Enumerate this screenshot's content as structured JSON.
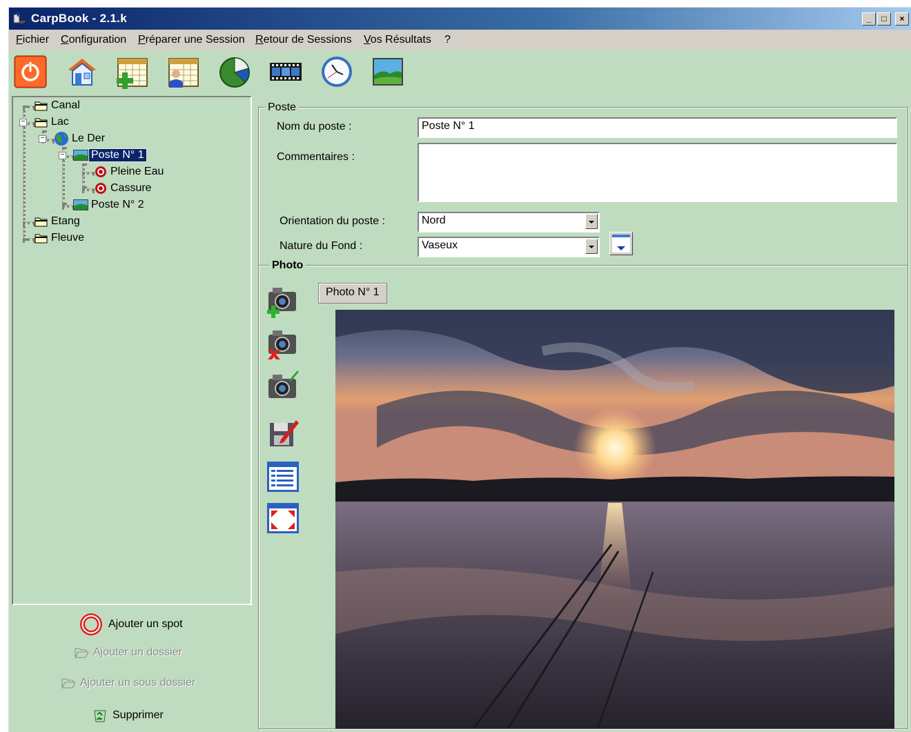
{
  "window": {
    "title": "CarpBook - 2.1.k"
  },
  "menu": [
    {
      "text": "Fichier",
      "mnemonic": "F",
      "rest": "ichier"
    },
    {
      "text": "Configuration",
      "mnemonic": "C",
      "rest": "onfiguration"
    },
    {
      "text": "Préparer une Session",
      "mnemonic": "P",
      "rest": "réparer une Session"
    },
    {
      "text": "Retour de Sessions",
      "mnemonic": "R",
      "rest": "etour de Sessions"
    },
    {
      "text": "Vos Résultats",
      "mnemonic": "V",
      "rest": "os Résultats"
    },
    {
      "text": "?",
      "mnemonic": "",
      "rest": "?"
    }
  ],
  "toolbar": [
    "power-icon",
    "house-icon",
    "calendar-add-icon",
    "calendar-person-icon",
    "pie-chart-icon",
    "film-icon",
    "clock-icon",
    "landscape-icon"
  ],
  "tree": {
    "canal": "Canal",
    "lac": "Lac",
    "le_der": "Le Der",
    "poste1": "Poste N° 1",
    "pleine_eau": "Pleine Eau",
    "cassure": "Cassure",
    "poste2": "Poste N° 2",
    "etang": "Etang",
    "fleuve": "Fleuve"
  },
  "actions": {
    "add_spot": "Ajouter un spot",
    "add_folder": "Ajouter un dossier",
    "add_subfolder": "Ajouter un sous dossier",
    "delete": "Supprimer"
  },
  "poste": {
    "group_title": "Poste",
    "name_label": "Nom du poste :",
    "name_value": "Poste N° 1",
    "comments_label": "Commentaires :",
    "comments_value": "",
    "orientation_label": "Orientation du poste :",
    "orientation_value": "Nord",
    "fond_label": "Nature du Fond :",
    "fond_value": "Vaseux"
  },
  "photo": {
    "group_title": "Photo",
    "tab_label": "Photo N° 1",
    "side_icons": [
      "camera-add-icon",
      "camera-delete-icon",
      "camera-edit-icon",
      "save-edit-icon",
      "list-icon",
      "fullscreen-icon"
    ]
  },
  "colors": {
    "background": "#c0dcc0",
    "title_bar": "#0a246a",
    "selection": "#0a246a"
  }
}
